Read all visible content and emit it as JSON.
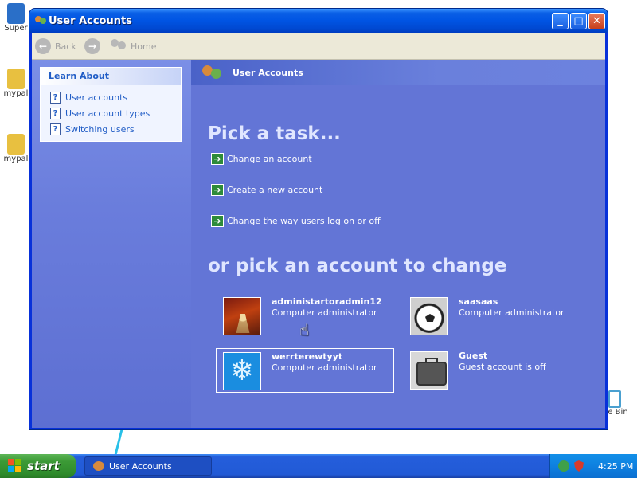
{
  "desktop": {
    "icons": [
      {
        "label": "Super",
        "color": "#2a6fc8"
      },
      {
        "label": "mypal",
        "color": "#e8c040"
      },
      {
        "label": "mypal",
        "color": "#e8c040"
      }
    ],
    "recycle_label": "e Bin"
  },
  "window": {
    "title": "User Accounts",
    "controls": {
      "minimize": "_",
      "maximize": "□",
      "close": "✕"
    },
    "toolbar": {
      "back": "Back",
      "home": "Home"
    }
  },
  "sidebar": {
    "heading": "Learn About",
    "items": [
      {
        "label": "User accounts",
        "icon": "help-icon"
      },
      {
        "label": "User account types",
        "icon": "help-icon"
      },
      {
        "label": "Switching users",
        "icon": "help-icon"
      }
    ]
  },
  "main": {
    "header_title": "User Accounts",
    "pick_task": "Pick a task...",
    "tasks": [
      {
        "label": "Change an account"
      },
      {
        "label": "Create a new account"
      },
      {
        "label": "Change the way users log on or off"
      }
    ],
    "pick_account": "or pick an account to change",
    "accounts": [
      {
        "name": "administartoradmin12",
        "type": "Computer administrator",
        "picture": "chess-pieces"
      },
      {
        "name": "saasaas",
        "type": "Computer administrator",
        "picture": "soccer-ball"
      },
      {
        "name": "werrterewtyyt",
        "type": "Computer administrator",
        "picture": "snowflake"
      },
      {
        "name": "Guest",
        "type": "Guest account is off",
        "picture": "suitcase"
      }
    ]
  },
  "taskbar": {
    "start_label": "start",
    "task_item": "User Accounts",
    "clock": "4:25 PM"
  },
  "colors": {
    "title_bar": "#0054e3",
    "main_pane": "#6375d6",
    "link_blue": "#215dc6",
    "start_green": "#3c9a36"
  }
}
